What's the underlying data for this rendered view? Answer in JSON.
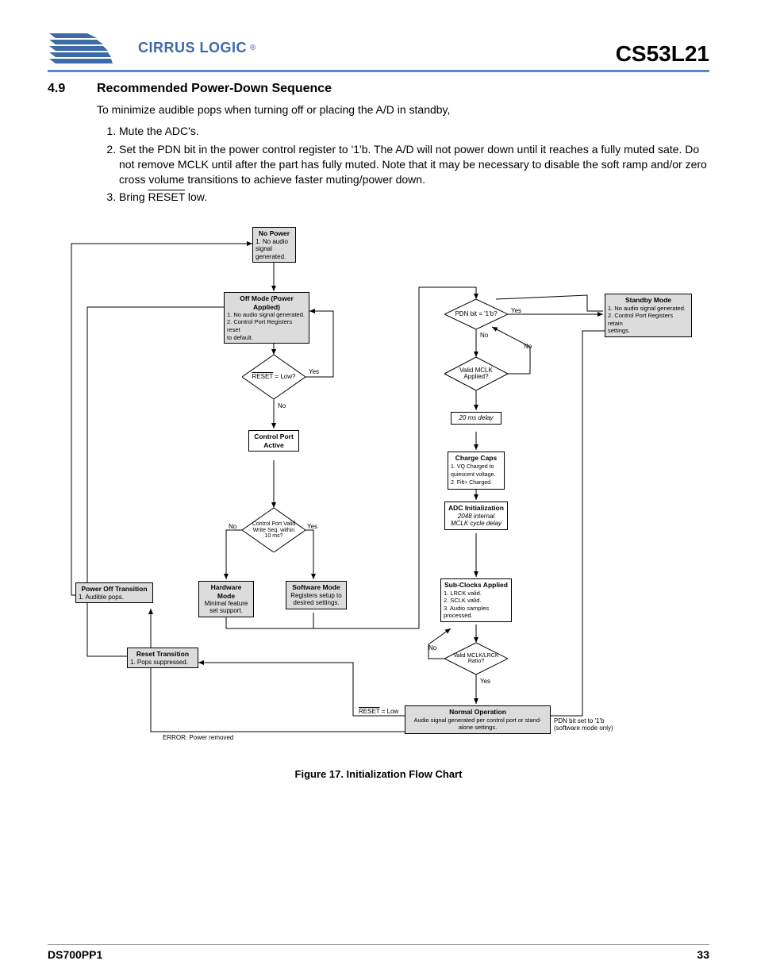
{
  "header": {
    "company": "CIRRUS LOGIC",
    "reg": "®",
    "part_number": "CS53L21"
  },
  "section": {
    "number": "4.9",
    "title": "Recommended Power-Down Sequence",
    "intro": "To minimize audible pops when turning off or placing the A/D in standby,",
    "steps": [
      "Mute the ADC's.",
      "Set the PDN bit in the power control register to '1'b. The A/D will not power down until it reaches a fully muted sate. Do not remove MCLK until after the part has fully muted. Note that it may be necessary to disable the soft ramp and/or zero cross volume transitions to achieve faster muting/power down.",
      "Bring RESET low."
    ]
  },
  "flowchart": {
    "no_power_title": "No Power",
    "no_power_body": "1. No audio signal\ngenerated.",
    "off_mode_title": "Off Mode (Power Applied)",
    "off_mode_body": "1. No audio signal generated.\n2. Control Port Registers reset\nto default.",
    "reset_low_q": "RESET = Low?",
    "control_port_active": "Control Port\nActive",
    "cp_valid_q": "Control Port Valid\nWrite Seq. within\n10 ms?",
    "hw_mode_title": "Hardware Mode",
    "hw_mode_body": "Minimal feature\nset support.",
    "sw_mode_title": "Software Mode",
    "sw_mode_body": "Registers setup to\ndesired settings.",
    "power_off_title": "Power Off Transition",
    "power_off_body": "1. Audible pops.",
    "reset_trans_title": "Reset Transition",
    "reset_trans_body": "1. Pops suppressed.",
    "pdn_q": "PDN bit = '1'b?",
    "valid_mclk_q": "Valid\nMCLK Applied?",
    "delay_20ms": "20 ms delay",
    "charge_caps_title": "Charge Caps",
    "charge_caps_body": "1. VQ Charged to\nquiescent voltage.\n2. Filt+ Charged.",
    "adc_init_title": "ADC Initialization",
    "adc_init_body": "2048 internal\nMCLK cycle delay",
    "subclocks_title": "Sub-Clocks Applied",
    "subclocks_body": "1. LRCK valid.\n2. SCLK valid.\n3. Audio samples\nprocessed.",
    "valid_ratio_q": "Valid\nMCLK/LRCK\nRatio?",
    "normal_op_title": "Normal Operation",
    "normal_op_body": "Audio signal generated per control port or stand-\nalone settings.",
    "standby_title": "Standby Mode",
    "standby_body": "1. No audio signal generated.\n2. Control Port Registers retain\nsettings.",
    "yes": "Yes",
    "no": "No",
    "reset_eq_low": "RESET = Low",
    "error_power_removed": "ERROR: Power removed",
    "pdn_set_body": "PDN bit set to '1'b\n(software mode only)"
  },
  "figure_caption": "Figure 17.  Initialization Flow Chart",
  "footer": {
    "left": "DS700PP1",
    "right": "33"
  }
}
